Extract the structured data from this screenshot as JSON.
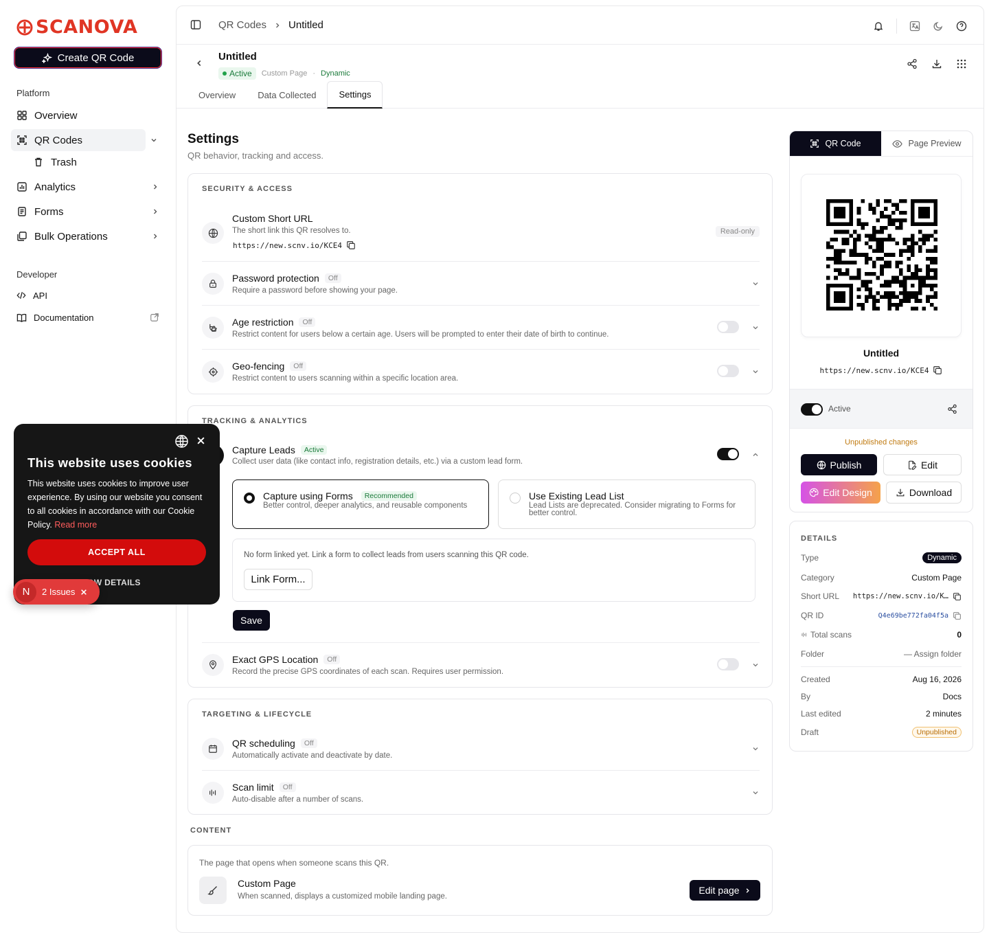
{
  "brand": {
    "name": "SCANOVA",
    "color": "#e03524"
  },
  "sidebar": {
    "create_label": "Create QR Code",
    "platform_label": "Platform",
    "items": [
      {
        "label": "Overview",
        "icon": "grid-icon"
      },
      {
        "label": "QR Codes",
        "icon": "qr-scan-icon"
      },
      {
        "label": "Trash",
        "icon": "trash-icon"
      },
      {
        "label": "Analytics",
        "icon": "bar-chart-icon"
      },
      {
        "label": "Forms",
        "icon": "form-icon"
      },
      {
        "label": "Bulk Operations",
        "icon": "layers-icon"
      }
    ],
    "developer_label": "Developer",
    "dev_items": [
      {
        "label": "API",
        "icon": "code-icon"
      },
      {
        "label": "Documentation",
        "icon": "book-icon"
      }
    ]
  },
  "topbar": {
    "crumb1": "QR Codes",
    "crumb2": "Untitled"
  },
  "header": {
    "title": "Untitled",
    "status": "Active",
    "category": "Custom Page",
    "sep": "·",
    "type": "Dynamic",
    "tabs": [
      "Overview",
      "Data Collected",
      "Settings"
    ]
  },
  "settings": {
    "title": "Settings",
    "subtitle": "QR behavior, tracking and access.",
    "security": {
      "heading": "SECURITY & ACCESS",
      "short_url": {
        "title": "Custom Short URL",
        "desc": "The short link this QR resolves to.",
        "url": "https://new.scnv.io/KCE4",
        "badge": "Read-only"
      },
      "password": {
        "title": "Password protection",
        "status": "Off",
        "desc": "Require a password before showing your page."
      },
      "age": {
        "title": "Age restriction",
        "status": "Off",
        "desc": "Restrict content for users below a certain age. Users will be prompted to enter their date of birth to continue."
      },
      "geo": {
        "title": "Geo-fencing",
        "status": "Off",
        "desc": "Restrict content to users scanning within a specific location area."
      }
    },
    "tracking": {
      "heading": "TRACKING & ANALYTICS",
      "leads": {
        "title": "Capture Leads",
        "status": "Active",
        "desc": "Collect user data (like contact info, registration details, etc.) via a custom lead form."
      },
      "opt1": {
        "title": "Capture using Forms",
        "badge": "Recommended",
        "desc": "Better control, deeper analytics, and reusable components"
      },
      "opt2": {
        "title": "Use Existing Lead List",
        "desc": "Lead Lists are deprecated. Consider migrating to Forms for better control."
      },
      "link_text": "No form linked yet. Link a form to collect leads from users scanning this QR code.",
      "link_btn": "Link Form...",
      "save": "Save",
      "gps": {
        "title": "Exact GPS Location",
        "status": "Off",
        "desc": "Record the precise GPS coordinates of each scan. Requires user permission."
      }
    },
    "targeting": {
      "heading": "TARGETING & LIFECYCLE",
      "schedule": {
        "title": "QR scheduling",
        "status": "Off",
        "desc": "Automatically activate and deactivate by date."
      },
      "limit": {
        "title": "Scan limit",
        "status": "Off",
        "desc": "Auto-disable after a number of scans."
      }
    },
    "content": {
      "heading": "CONTENT",
      "desc": "The page that opens when someone scans this QR.",
      "title": "Custom Page",
      "sub": "When scanned, displays a customized mobile landing page.",
      "btn": "Edit page"
    }
  },
  "panel": {
    "tab_qr": "QR Code",
    "tab_preview": "Page Preview",
    "name": "Untitled",
    "url": "https://new.scnv.io/KCE4",
    "active_label": "Active",
    "unpublished": "Unpublished changes",
    "publish": "Publish",
    "edit": "Edit",
    "edit_design": "Edit Design",
    "download": "Download"
  },
  "details": {
    "heading": "DETAILS",
    "type_k": "Type",
    "type_v": "Dynamic",
    "category_k": "Category",
    "category_v": "Custom Page",
    "short_k": "Short URL",
    "short_v": "https://new.scnv.io/K…",
    "qrid_k": "QR ID",
    "qrid_v": "Q4e69be772fa04f5a",
    "scans_k": "Total scans",
    "scans_v": "0",
    "folder_k": "Folder",
    "folder_v": "— Assign folder",
    "created_k": "Created",
    "created_v": "Aug 16, 2026",
    "by_k": "By",
    "by_v": "Docs",
    "edited_k": "Last edited",
    "edited_v": "2 minutes",
    "draft_k": "Draft",
    "draft_v": "Unpublished"
  },
  "cookie": {
    "title": "This website uses cookies",
    "body": "This website uses cookies to improve user experience. By using our website you consent to all cookies in accordance with our Cookie Policy.",
    "read_more": "Read more",
    "accept": "ACCEPT ALL",
    "details": "SHOW DETAILS"
  },
  "issues": {
    "initial": "N",
    "label": "2 Issues"
  }
}
